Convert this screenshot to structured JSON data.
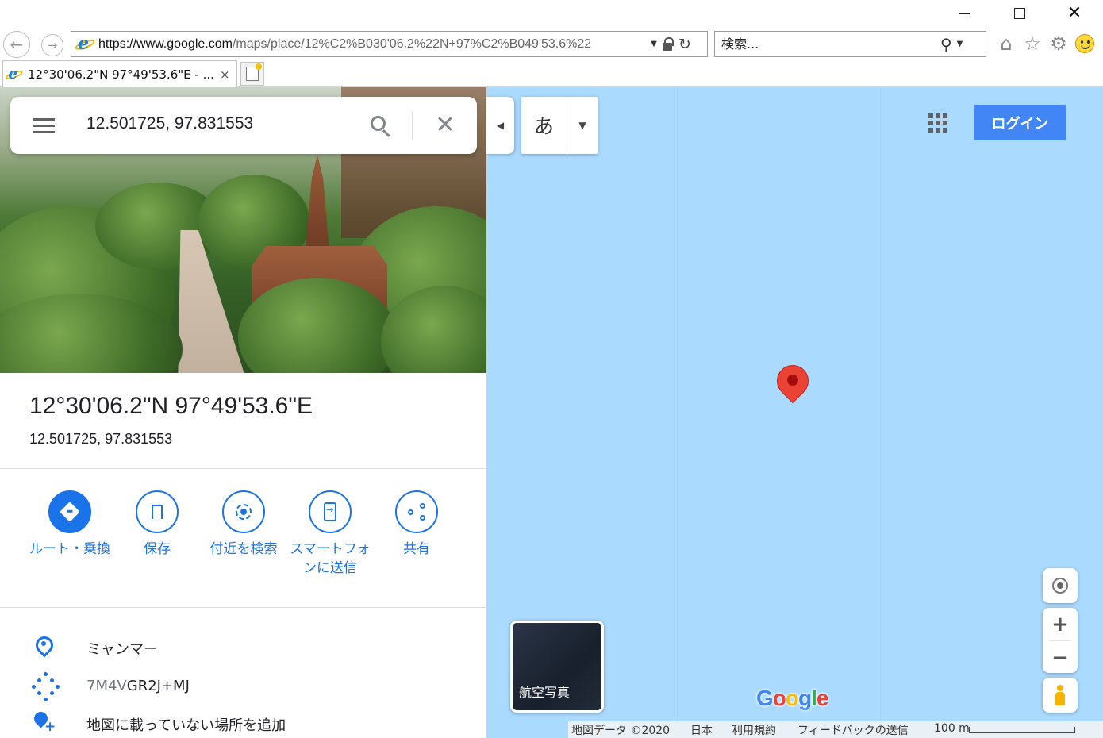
{
  "window": {
    "minimize": "",
    "maximize": "",
    "close": "✕"
  },
  "browser": {
    "url_host": "https://www.google.com",
    "url_path": "/maps/place/12%C2%B030'06.2%22N+97%C2%B049'53.6%22",
    "search_placeholder": "検索...",
    "tab_title": "12°30'06.2\"N 97°49'53.6\"E - ...",
    "tab_close": "×"
  },
  "search": {
    "query": "12.501725, 97.831553",
    "clear": "✕"
  },
  "place": {
    "title": "12°30'06.2\"N 97°49'53.6\"E",
    "subtitle": "12.501725, 97.831553"
  },
  "actions": [
    {
      "label": "ルート・乗換",
      "icon": "directions-icon"
    },
    {
      "label": "保存",
      "icon": "bookmark-icon"
    },
    {
      "label": "付近を検索",
      "icon": "nearby-icon"
    },
    {
      "label": "スマートフォンに送信",
      "icon": "send-to-phone-icon"
    },
    {
      "label": "共有",
      "icon": "share-icon"
    }
  ],
  "info": {
    "country": "ミャンマー",
    "plus_code_prefix": "7M4V",
    "plus_code_main": "GR2J+MJ",
    "add_place": "地図に載っていない場所を追加"
  },
  "map": {
    "ime_key": "あ",
    "login": "ログイン",
    "aerial_label": "航空写真",
    "logo_letters": [
      "G",
      "o",
      "o",
      "g",
      "l",
      "e"
    ],
    "footer": {
      "data": "地図データ ©2020",
      "region": "日本",
      "terms": "利用規約",
      "feedback": "フィードバックの送信",
      "scale": "100 m"
    }
  },
  "colors": {
    "accent": "#1a73e8",
    "map_water": "#abdaff",
    "marker": "#ea4335",
    "login_bg": "#4285f4"
  }
}
